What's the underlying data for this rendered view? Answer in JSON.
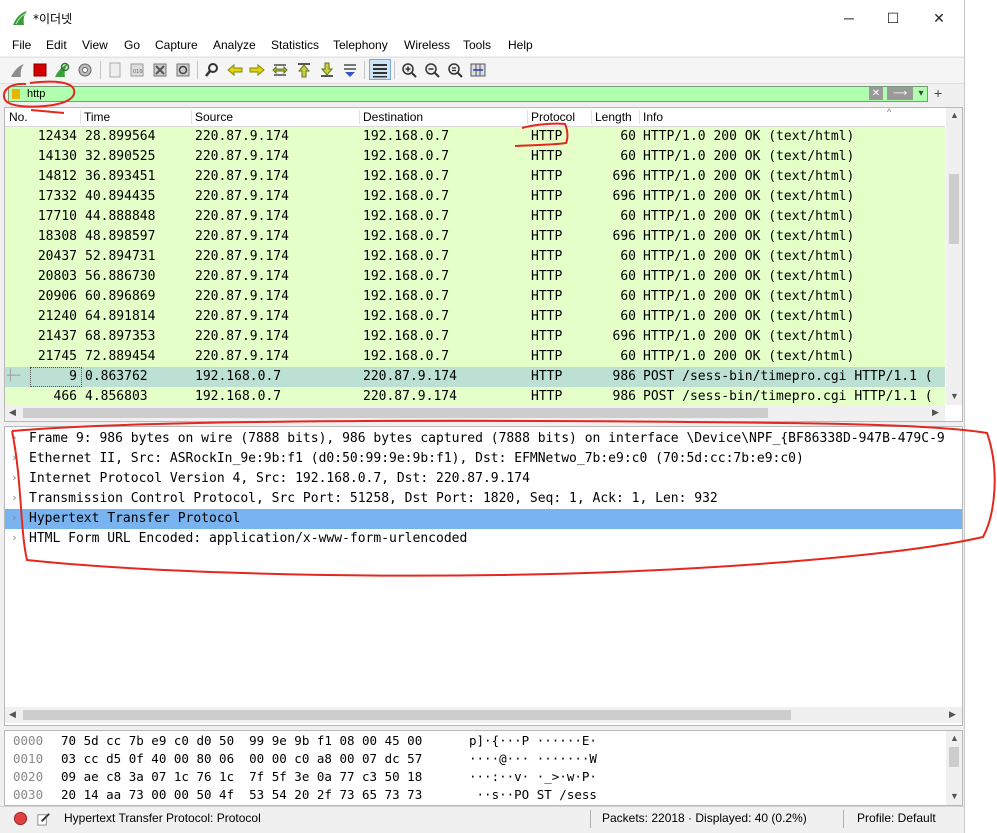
{
  "window": {
    "title": "*이더넷",
    "minimize": "─",
    "maximize": "☐",
    "close": "✕"
  },
  "menu": [
    "File",
    "Edit",
    "View",
    "Go",
    "Capture",
    "Analyze",
    "Statistics",
    "Telephony",
    "Wireless",
    "Tools",
    "Help"
  ],
  "filter": {
    "value": "http",
    "clear": "✕",
    "apply": "⟶",
    "dropdown": "▾",
    "add": "+"
  },
  "columns": {
    "no": "No.",
    "time": "Time",
    "source": "Source",
    "destination": "Destination",
    "protocol": "Protocol",
    "length": "Length",
    "info": "Info"
  },
  "packets": [
    {
      "no": "12434",
      "time": "28.899564",
      "src": "220.87.9.174",
      "dst": "192.168.0.7",
      "proto": "HTTP",
      "len": "60",
      "info": "HTTP/1.0 200 OK  (text/html)"
    },
    {
      "no": "14130",
      "time": "32.890525",
      "src": "220.87.9.174",
      "dst": "192.168.0.7",
      "proto": "HTTP",
      "len": "60",
      "info": "HTTP/1.0 200 OK  (text/html)"
    },
    {
      "no": "14812",
      "time": "36.893451",
      "src": "220.87.9.174",
      "dst": "192.168.0.7",
      "proto": "HTTP",
      "len": "696",
      "info": "HTTP/1.0 200 OK  (text/html)"
    },
    {
      "no": "17332",
      "time": "40.894435",
      "src": "220.87.9.174",
      "dst": "192.168.0.7",
      "proto": "HTTP",
      "len": "696",
      "info": "HTTP/1.0 200 OK  (text/html)"
    },
    {
      "no": "17710",
      "time": "44.888848",
      "src": "220.87.9.174",
      "dst": "192.168.0.7",
      "proto": "HTTP",
      "len": "60",
      "info": "HTTP/1.0 200 OK  (text/html)"
    },
    {
      "no": "18308",
      "time": "48.898597",
      "src": "220.87.9.174",
      "dst": "192.168.0.7",
      "proto": "HTTP",
      "len": "696",
      "info": "HTTP/1.0 200 OK  (text/html)"
    },
    {
      "no": "20437",
      "time": "52.894731",
      "src": "220.87.9.174",
      "dst": "192.168.0.7",
      "proto": "HTTP",
      "len": "60",
      "info": "HTTP/1.0 200 OK  (text/html)"
    },
    {
      "no": "20803",
      "time": "56.886730",
      "src": "220.87.9.174",
      "dst": "192.168.0.7",
      "proto": "HTTP",
      "len": "60",
      "info": "HTTP/1.0 200 OK  (text/html)"
    },
    {
      "no": "20906",
      "time": "60.896869",
      "src": "220.87.9.174",
      "dst": "192.168.0.7",
      "proto": "HTTP",
      "len": "60",
      "info": "HTTP/1.0 200 OK  (text/html)"
    },
    {
      "no": "21240",
      "time": "64.891814",
      "src": "220.87.9.174",
      "dst": "192.168.0.7",
      "proto": "HTTP",
      "len": "60",
      "info": "HTTP/1.0 200 OK  (text/html)"
    },
    {
      "no": "21437",
      "time": "68.897353",
      "src": "220.87.9.174",
      "dst": "192.168.0.7",
      "proto": "HTTP",
      "len": "696",
      "info": "HTTP/1.0 200 OK  (text/html)"
    },
    {
      "no": "21745",
      "time": "72.889454",
      "src": "220.87.9.174",
      "dst": "192.168.0.7",
      "proto": "HTTP",
      "len": "60",
      "info": "HTTP/1.0 200 OK  (text/html)"
    },
    {
      "no": "9",
      "time": "0.863762",
      "src": "192.168.0.7",
      "dst": "220.87.9.174",
      "proto": "HTTP",
      "len": "986",
      "info": "POST /sess-bin/timepro.cgi HTTP/1.1  (",
      "selected": true
    },
    {
      "no": "466",
      "time": "4.856803",
      "src": "192.168.0.7",
      "dst": "220.87.9.174",
      "proto": "HTTP",
      "len": "986",
      "info": "POST /sess-bin/timepro.cgi HTTP/1.1  ("
    }
  ],
  "details": [
    {
      "text": "Frame 9: 986 bytes on wire (7888 bits), 986 bytes captured (7888 bits) on interface \\Device\\NPF_{BF86338D-947B-479C-9"
    },
    {
      "text": "Ethernet II, Src: ASRockIn_9e:9b:f1 (d0:50:99:9e:9b:f1), Dst: EFMNetwo_7b:e9:c0 (70:5d:cc:7b:e9:c0)"
    },
    {
      "text": "Internet Protocol Version 4, Src: 192.168.0.7, Dst: 220.87.9.174"
    },
    {
      "text": "Transmission Control Protocol, Src Port: 51258, Dst Port: 1820, Seq: 1, Ack: 1, Len: 932"
    },
    {
      "text": "Hypertext Transfer Protocol",
      "selected": true
    },
    {
      "text": "HTML Form URL Encoded: application/x-www-form-urlencoded"
    }
  ],
  "hex": [
    {
      "offset": "0000",
      "bytes": "70 5d cc 7b e9 c0 d0 50  99 9e 9b f1 08 00 45 00",
      "ascii": "p]·{···P ······E·"
    },
    {
      "offset": "0010",
      "bytes": "03 cc d5 0f 40 00 80 06  00 00 c0 a8 00 07 dc 57",
      "ascii": "····@··· ·······W"
    },
    {
      "offset": "0020",
      "bytes": "09 ae c8 3a 07 1c 76 1c  7f 5f 3e 0a 77 c3 50 18",
      "ascii": "···:··v· ·_>·w·P·"
    },
    {
      "offset": "0030",
      "bytes": "20 14 aa 73 00 00 50 4f  53 54 20 2f 73 65 73 73",
      "ascii": " ··s··PO ST /sess"
    }
  ],
  "status": {
    "protocol": "Hypertext Transfer Protocol: Protocol",
    "packets": "Packets: 22018 · Displayed: 40 (0.2%)",
    "profile": "Profile: Default"
  },
  "colors": {
    "http_row": "#e4ffc7",
    "selected_row": "#bde0d5",
    "selected_detail": "#79b3f0",
    "filter_valid": "#afffaf",
    "annotation": "#e5281e"
  },
  "icons": [
    "shark-fin-icon",
    "stop-icon",
    "restart-icon",
    "options-icon",
    "open-icon",
    "save-icon",
    "close-file-icon",
    "reload-icon",
    "find-icon",
    "back-icon",
    "forward-icon",
    "goto-icon",
    "first-icon",
    "last-icon",
    "autoscroll-icon",
    "colorize-icon",
    "zoom-in-icon",
    "zoom-out-icon",
    "normal-size-icon",
    "resize-columns-icon"
  ]
}
